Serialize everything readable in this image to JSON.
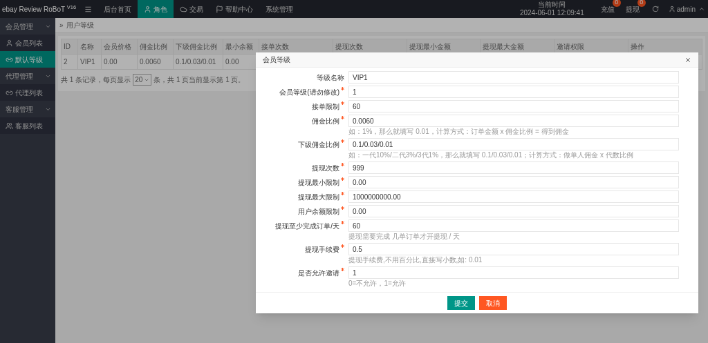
{
  "logo": "ebay Review RoBoT $^{V16}$",
  "nav": [
    {
      "label": "后台首页",
      "selected": false
    },
    {
      "label": "角色",
      "selected": true
    },
    {
      "label": "交易",
      "selected": false
    },
    {
      "label": "帮助中心",
      "selected": false
    },
    {
      "label": "系统管理",
      "selected": false
    }
  ],
  "clock": {
    "label": "当前时间",
    "value": "2024-06-01 12:09:41"
  },
  "top_actions": [
    {
      "label": "充值",
      "badge": "0"
    },
    {
      "label": "提现",
      "badge": "0"
    }
  ],
  "user": "admin",
  "sidebar": [
    {
      "label": "会员管理",
      "expanded": true,
      "children": [
        {
          "label": "会员列表",
          "selected": false
        },
        {
          "label": "默认等级",
          "selected": true
        }
      ]
    },
    {
      "label": "代理管理",
      "expanded": true,
      "children": [
        {
          "label": "代理列表",
          "selected": false
        }
      ]
    },
    {
      "label": "客服管理",
      "expanded": true,
      "children": [
        {
          "label": "客服列表",
          "selected": false
        }
      ]
    }
  ],
  "breadcrumb": {
    "separator": "»",
    "label": "用户等级"
  },
  "table": {
    "columns": [
      "ID",
      "名称",
      "会员价格",
      "佣金比例",
      "下级佣金比例",
      "最小余额",
      "接单次数",
      "提现次数",
      "提现最小金额",
      "提现最大金额",
      "邀请权限",
      "操作"
    ],
    "rows": [
      [
        "2",
        "VIP1",
        "0.00",
        "0.0060",
        "0.1/0.03/0.01",
        "0.00"
      ]
    ]
  },
  "pagination": {
    "before": "共 1 条记录，每页显示",
    "page_size": "20",
    "after": "条，共 1 页当前显示第 1 页。"
  },
  "modal": {
    "title": "会员等级",
    "fields": [
      {
        "label": "等级名称",
        "required": false,
        "value": "VIP1"
      },
      {
        "label": "会员等级(请勿修改)",
        "required": true,
        "value": "1"
      },
      {
        "label": "接单限制",
        "required": true,
        "value": "60"
      },
      {
        "label": "佣金比例",
        "required": true,
        "value": "0.0060",
        "hint": "如：1%，那么就填写 0.01，计算方式：订单金额 x 佣金比例 = 得到佣金"
      },
      {
        "label": "下级佣金比例",
        "required": true,
        "value": "0.1/0.03/0.01",
        "hint": "如：一代10%/二代3%/3代1%，那么就填写 0.1/0.03/0.01；计算方式：做单人佣金 x 代数比例"
      },
      {
        "label": "提现次数",
        "required": true,
        "value": "999"
      },
      {
        "label": "提现最小限制",
        "required": true,
        "value": "0.00"
      },
      {
        "label": "提现最大限制",
        "required": true,
        "value": "1000000000.00"
      },
      {
        "label": "用户余额限制",
        "required": true,
        "value": "0.00"
      },
      {
        "label": "提现至少完成订单/天",
        "required": true,
        "value": "60",
        "hint": "提现需要完成 几单订单才开提现 / 天"
      },
      {
        "label": "提现手续费",
        "required": true,
        "value": "0.5",
        "hint": "提现手续费,不用百分比,直接写小数,如: 0.01"
      },
      {
        "label": "是否允许邀请",
        "required": true,
        "value": "1",
        "hint": "0=不允许，1=允许"
      }
    ],
    "buttons": [
      {
        "label": "提交",
        "kind": "primary"
      },
      {
        "label": "取消",
        "kind": "danger"
      }
    ]
  }
}
